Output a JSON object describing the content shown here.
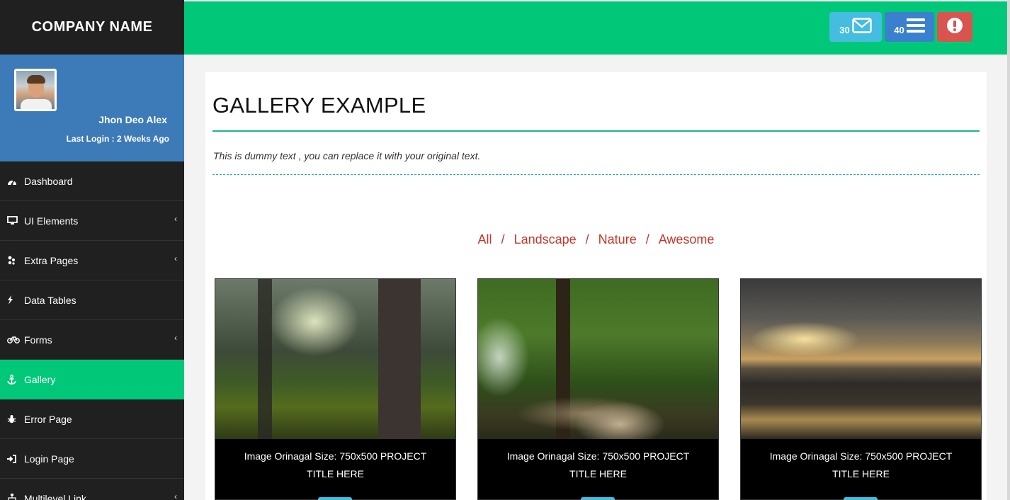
{
  "brand": {
    "name": "COMPANY NAME"
  },
  "user": {
    "name": "Jhon Deo Alex",
    "last_login": "Last Login : 2 Weeks Ago"
  },
  "sidebar": {
    "items": [
      {
        "label": "Dashboard",
        "icon": "dashboard-icon",
        "has_submenu": false,
        "active": false
      },
      {
        "label": "UI Elements",
        "icon": "desktop-icon",
        "has_submenu": true,
        "active": false
      },
      {
        "label": "Extra Pages",
        "icon": "yelp-icon",
        "has_submenu": true,
        "active": false
      },
      {
        "label": "Data Tables",
        "icon": "bolt-icon",
        "has_submenu": false,
        "active": false
      },
      {
        "label": "Forms",
        "icon": "bicycle-icon",
        "has_submenu": true,
        "active": false
      },
      {
        "label": "Gallery",
        "icon": "anchor-icon",
        "has_submenu": false,
        "active": true
      },
      {
        "label": "Error Page",
        "icon": "bug-icon",
        "has_submenu": false,
        "active": false
      },
      {
        "label": "Login Page",
        "icon": "sign-in-icon",
        "has_submenu": false,
        "active": false
      },
      {
        "label": "Multilevel Link",
        "icon": "sitemap-icon",
        "has_submenu": true,
        "active": false
      }
    ]
  },
  "topbar": {
    "messages_count": "30",
    "tasks_count": "40"
  },
  "main": {
    "title": "GALLERY EXAMPLE",
    "subtitle": "This is dummy text , you can replace it with your original text.",
    "filters": [
      "All",
      "Landscape",
      "Nature",
      "Awesome"
    ],
    "gallery": [
      {
        "caption": "Image Orinagal Size: 750x500 PROJECT TITLE HERE",
        "image": "forest-photo"
      },
      {
        "caption": "Image Orinagal Size: 750x500 PROJECT TITLE HERE",
        "image": "forest-road-photo"
      },
      {
        "caption": "Image Orinagal Size: 750x500 PROJECT TITLE HERE",
        "image": "beach-sunset-photo"
      }
    ]
  },
  "colors": {
    "accent_green": "#00c878",
    "user_panel_blue": "#3d7ab8",
    "sidebar_dark": "#202020",
    "mail_button": "#45bde0",
    "tasks_button": "#3a80cf",
    "alert_button": "#d9534f",
    "filter_link": "#c0392b"
  }
}
